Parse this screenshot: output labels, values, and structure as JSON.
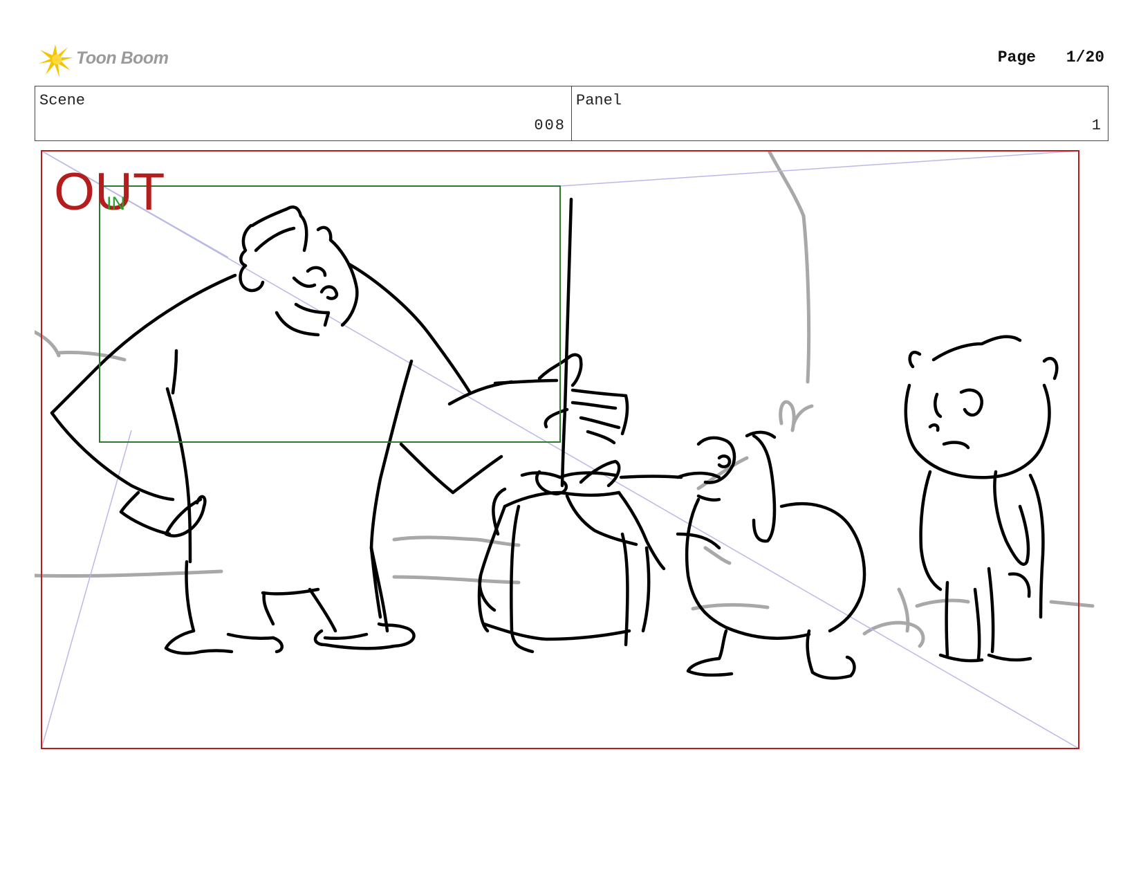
{
  "header": {
    "logo_text": "Toon Boom",
    "page_label": "Page",
    "page_value": "1/20"
  },
  "info": {
    "scene_label": "Scene",
    "scene_value": "008",
    "panel_label": "Panel",
    "panel_value": "1"
  },
  "frames": {
    "out_label": "OUT",
    "in_label": "IN"
  },
  "colors": {
    "out_frame": "#b51d1d",
    "in_frame": "#2b7a2b",
    "guides": "#b9b9e8",
    "sketch": "#000000",
    "background_sketch": "#a8a8a8"
  }
}
